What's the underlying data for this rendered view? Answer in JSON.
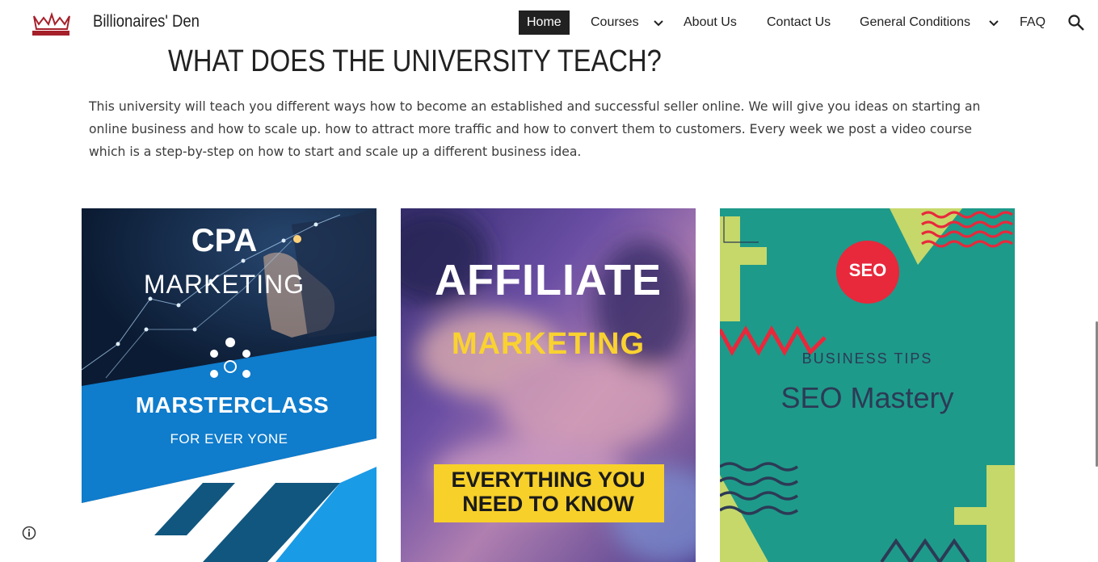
{
  "header": {
    "site_title": "Billionaires' Den",
    "logo_text": "BILLIONAIRES' DEN",
    "nav": {
      "home": "Home",
      "courses": "Courses",
      "about": "About Us",
      "contact": "Contact Us",
      "general": "General Conditions",
      "faq": "FAQ"
    }
  },
  "main": {
    "heading": "WHAT DOES THE UNIVERSITY TEACH?",
    "paragraph_lines": [
      "This university will teach you different ways how to become an established and successful seller online. We will give you ideas on starting an",
      "online business and how to scale up. how to attract more traffic and how to convert them to customers. Every week we post a video course",
      "which is a step-by-step on how to start and scale up a different business idea."
    ]
  },
  "cards": {
    "cpa": {
      "title": "CPA",
      "subtitle": "MARKETING",
      "line3": "MARSTERCLASS",
      "line4": "FOR EVER YONE"
    },
    "affiliate": {
      "title": "AFFILIATE",
      "subtitle": "MARKETING",
      "box_line1": "EVERYTHING YOU",
      "box_line2": "NEED TO KNOW"
    },
    "seo": {
      "badge": "SEO",
      "tag": "BUSINESS TIPS",
      "title": "SEO Mastery"
    }
  },
  "icons": [
    "logo-icon",
    "chevron-down-icon",
    "search-icon",
    "info-icon"
  ],
  "colors": {
    "nav_active_bg": "#212121",
    "card1_bg": "#0e2340",
    "card1_accent": "#1a82d0",
    "card2_yellow": "#f7d02a",
    "card3_teal": "#1e9a8a",
    "card3_red": "#e8283b",
    "card3_lime": "#c6d86a"
  }
}
